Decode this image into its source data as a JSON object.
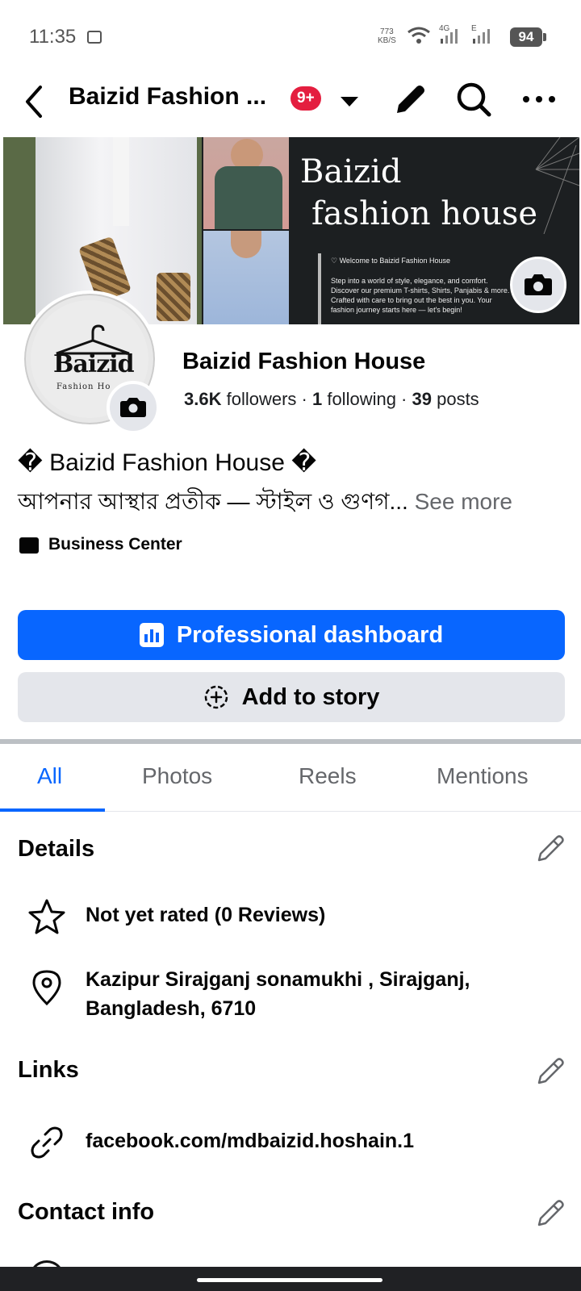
{
  "status_bar": {
    "time": "11:35",
    "net_speed_value": "773",
    "net_speed_unit": "KB/S",
    "sig1_label": "4G",
    "sig2_label": "E",
    "battery": "94"
  },
  "header": {
    "title": "Baizid Fashion ...",
    "notification_badge": "9+"
  },
  "cover": {
    "title_line1": "Baizid",
    "title_line2": "fashion house",
    "welcome": "♡ Welcome to Baizid Fashion House",
    "description": "Step into a world of style, elegance, and comfort. Discover our premium T-shirts, Shirts, Panjabis & more. Crafted with care to bring out the best in you. Your fashion journey starts here — let's begin!"
  },
  "avatar": {
    "brand": "Baizid",
    "sub": "Fashion Ho"
  },
  "profile": {
    "name": "Baizid Fashion House",
    "followers_count": "3.6K",
    "followers_label": " followers · ",
    "following_count": "1",
    "following_label": " following · ",
    "posts_count": "39",
    "posts_label": " posts",
    "bio_line1": "� Baizid Fashion House �",
    "bio_line2": "আপনার আস্থার প্রতীক — স্টাইল ও গুণগ...",
    "see_more": " See more",
    "business_center": "Business Center"
  },
  "buttons": {
    "professional_dashboard": "Professional dashboard",
    "add_to_story": "Add to story"
  },
  "tabs": [
    "All",
    "Photos",
    "Reels",
    "Mentions"
  ],
  "active_tab": "All",
  "details": {
    "title": "Details",
    "rating": "Not yet rated (0 Reviews)",
    "address_line1": "Kazipur Sirajganj sonamukhi , Sirajganj,",
    "address_line2": "Bangladesh, 6710"
  },
  "links": {
    "title": "Links",
    "url": "facebook.com/mdbaizid.hoshain.1"
  },
  "contact": {
    "title": "Contact info"
  },
  "colors": {
    "primary": "#0866ff",
    "badge": "#e41e3f",
    "secondary_button": "#e4e6eb",
    "muted_text": "#65676b"
  }
}
